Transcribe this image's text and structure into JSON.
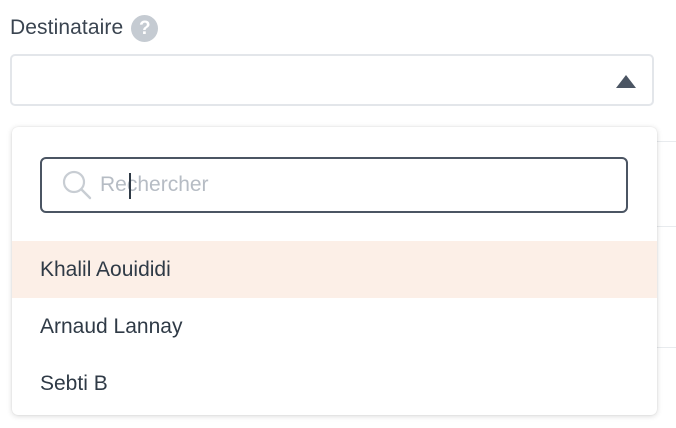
{
  "field": {
    "label": "Destinataire",
    "help_glyph": "?",
    "selected_value": ""
  },
  "dropdown": {
    "search": {
      "placeholder": "Rechercher",
      "value": ""
    },
    "options": [
      {
        "label": "Khalil Aouididi",
        "highlighted": true
      },
      {
        "label": "Arnaud Lannay",
        "highlighted": false
      },
      {
        "label": "Sebti B",
        "highlighted": false
      }
    ]
  },
  "colors": {
    "highlight": "#fcefe7",
    "border_focus": "#4b5563",
    "border_default": "#e3e6ea",
    "help_icon_bg": "#c5cbd2"
  },
  "icons": {
    "help": "question-circle-icon",
    "arrow": "caret-up-icon",
    "search": "search-icon"
  }
}
